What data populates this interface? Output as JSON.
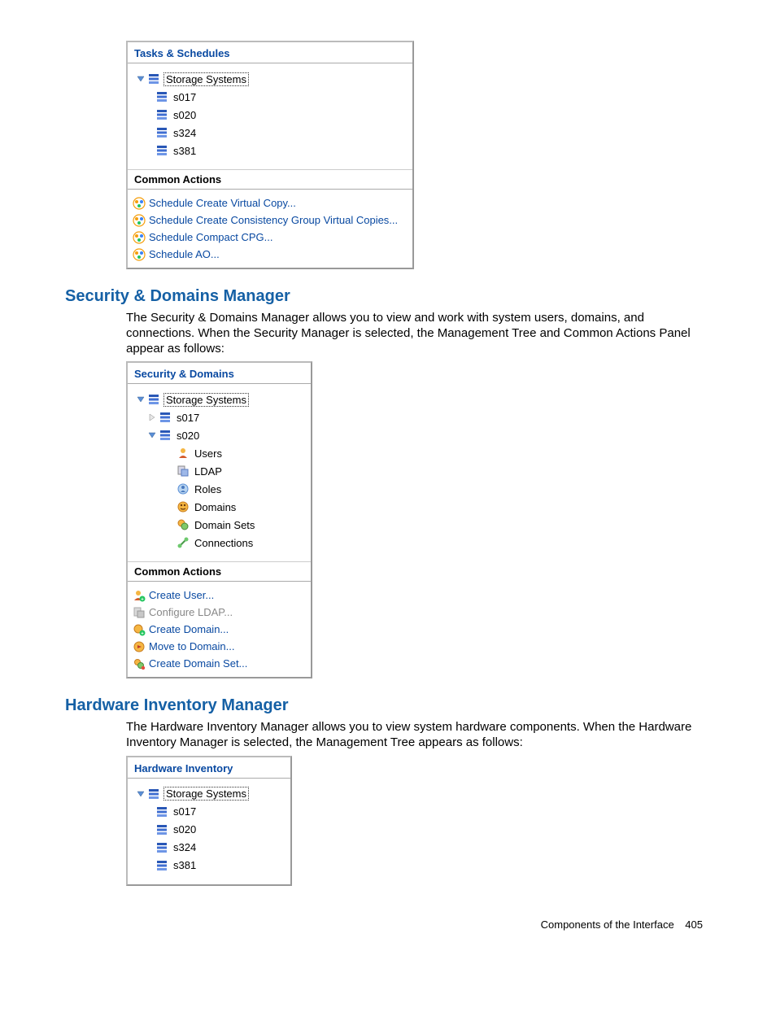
{
  "panel1": {
    "title": "Tasks & Schedules",
    "root": "Storage Systems",
    "children": [
      "s017",
      "s020",
      "s324",
      "s381"
    ],
    "common_label": "Common Actions",
    "actions": [
      "Schedule Create Virtual Copy...",
      "Schedule Create Consistency Group Virtual Copies...",
      "Schedule Compact CPG...",
      "Schedule AO..."
    ]
  },
  "section1": {
    "heading": "Security & Domains Manager",
    "body": "The Security & Domains Manager allows you to view and work with system users, domains, and connections. When the Security Manager is selected, the Management Tree and Common Actions Panel appear as follows:"
  },
  "panel2": {
    "title": "Security & Domains",
    "root": "Storage Systems",
    "child1": "s017",
    "child2": "s020",
    "sub": [
      "Users",
      "LDAP",
      "Roles",
      "Domains",
      "Domain Sets",
      "Connections"
    ],
    "common_label": "Common Actions",
    "actions": [
      {
        "label": "Create User...",
        "disabled": false
      },
      {
        "label": "Configure LDAP...",
        "disabled": true
      },
      {
        "label": "Create Domain...",
        "disabled": false
      },
      {
        "label": "Move to Domain...",
        "disabled": false
      },
      {
        "label": "Create Domain Set...",
        "disabled": false
      }
    ]
  },
  "section2": {
    "heading": "Hardware Inventory Manager",
    "body": "The Hardware Inventory Manager allows you to view system hardware components. When the Hardware Inventory Manager is selected, the Management Tree appears as follows:"
  },
  "panel3": {
    "title": "Hardware Inventory",
    "root": "Storage Systems",
    "children": [
      "s017",
      "s020",
      "s324",
      "s381"
    ]
  },
  "footer": {
    "text": "Components of the Interface",
    "page": "405"
  }
}
